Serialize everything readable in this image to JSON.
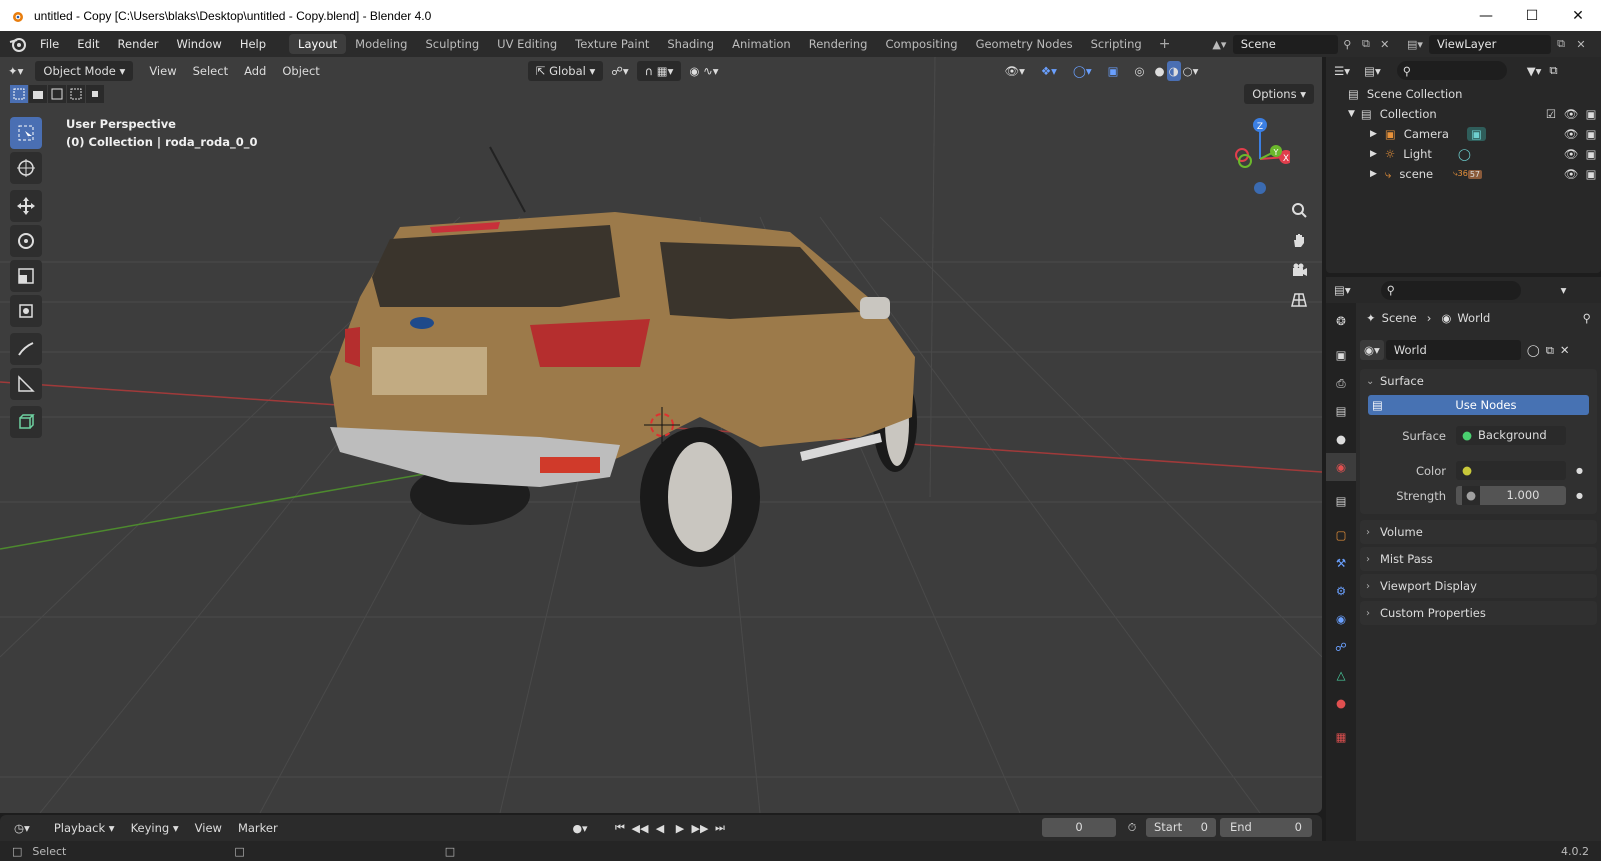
{
  "window": {
    "title": "untitled - Copy [C:\\Users\\blaks\\Desktop\\untitled - Copy.blend] - Blender 4.0",
    "controls": [
      "minimize",
      "maximize",
      "close"
    ]
  },
  "menu": {
    "items": [
      "File",
      "Edit",
      "Render",
      "Window",
      "Help"
    ],
    "workspace_tabs": [
      "Layout",
      "Modeling",
      "Sculpting",
      "UV Editing",
      "Texture Paint",
      "Shading",
      "Animation",
      "Rendering",
      "Compositing",
      "Geometry Nodes",
      "Scripting"
    ],
    "active_tab": "Layout",
    "scene": "Scene",
    "view_layer": "ViewLayer"
  },
  "viewport": {
    "mode": "Object Mode",
    "menus": [
      "View",
      "Select",
      "Add",
      "Object"
    ],
    "transform_orientation": "Global",
    "options_label": "Options",
    "overlay_line1": "User Perspective",
    "overlay_line2": "(0) Collection | roda_roda_0_0",
    "gizmo_axes": {
      "x": "X",
      "y": "Y",
      "z": "Z"
    }
  },
  "outliner": {
    "root": "Scene Collection",
    "collection": "Collection",
    "items": [
      {
        "name": "Camera",
        "icon": "camera-icon"
      },
      {
        "name": "Light",
        "icon": "light-icon"
      },
      {
        "name": "scene",
        "icon": "empty-icon",
        "badge": "36",
        "badge2": "57"
      }
    ]
  },
  "properties": {
    "breadcrumb_scene": "Scene",
    "breadcrumb_world": "World",
    "world_name": "World",
    "surface_panel": "Surface",
    "use_nodes_label": "Use Nodes",
    "surface_label": "Surface",
    "surface_value": "Background",
    "color_label": "Color",
    "strength_label": "Strength",
    "strength_value": "1.000",
    "collapsed_panels": [
      "Volume",
      "Mist Pass",
      "Viewport Display",
      "Custom Properties"
    ]
  },
  "timeline": {
    "menus": [
      "Playback",
      "Keying",
      "View",
      "Marker"
    ],
    "current_frame": "0",
    "start_label": "Start",
    "start_value": "0",
    "end_label": "End",
    "end_value": "0"
  },
  "statusbar": {
    "left_label": "Select",
    "version": "4.0.2"
  },
  "colors": {
    "accent": "#4772b3",
    "x_axis": "#e03e4c",
    "y_axis": "#6bb82c",
    "z_axis": "#3b7fe3",
    "car_paint": "#9c7a4a"
  }
}
